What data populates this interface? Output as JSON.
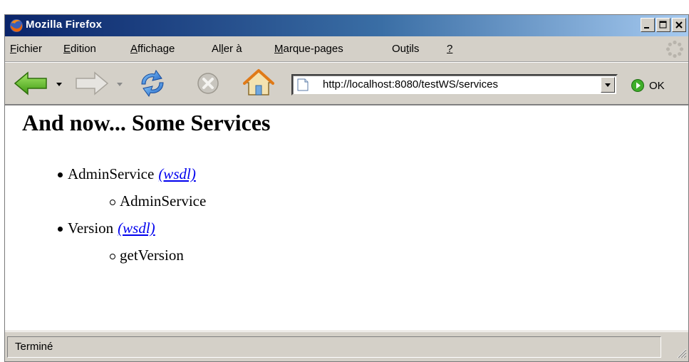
{
  "window": {
    "title": "Mozilla Firefox"
  },
  "menu": {
    "items": [
      {
        "key": "F",
        "rest": "ichier"
      },
      {
        "key": "E",
        "rest": "dition"
      },
      {
        "key": "A",
        "rest": "ffichage"
      },
      {
        "pre": "Al",
        "key": "l",
        "rest": "er à"
      },
      {
        "key": "M",
        "rest": "arque-pages"
      },
      {
        "pre": "Ou",
        "key": "t",
        "rest": "ils"
      },
      {
        "key": "?",
        "rest": ""
      }
    ]
  },
  "toolbar": {
    "url": "http://localhost:8080/testWS/services",
    "go_label": "OK",
    "icons": [
      "back-icon",
      "forward-icon",
      "reload-icon",
      "stop-icon",
      "home-icon",
      "go-icon"
    ]
  },
  "page": {
    "heading": "And now... Some Services",
    "services": [
      {
        "name": "AdminService",
        "link_text": "(wsdl)",
        "operations": [
          "AdminService"
        ]
      },
      {
        "name": "Version",
        "link_text": "(wsdl)",
        "operations": [
          "getVersion"
        ]
      }
    ]
  },
  "status": {
    "text": "Terminé"
  },
  "colors": {
    "title_bar_start": "#0a246a",
    "title_bar_end": "#a6caf0",
    "chrome": "#d4d0c8",
    "link": "#0000ee"
  }
}
